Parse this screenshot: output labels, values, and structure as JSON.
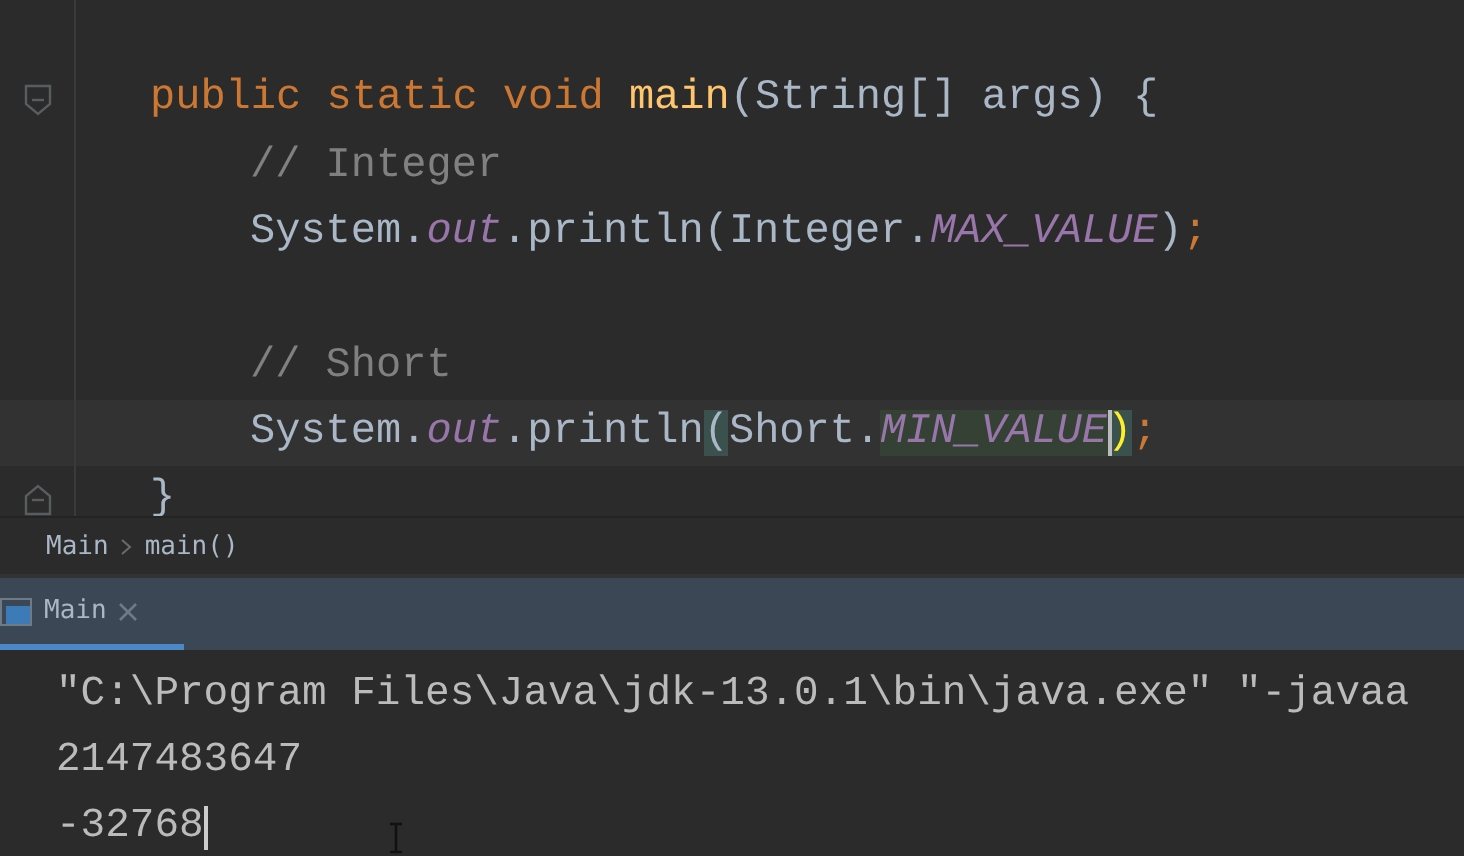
{
  "editor": {
    "lines": [
      {
        "kind": "blank"
      },
      {
        "kind": "fold-start",
        "tokens": [
          {
            "kind": "keyword",
            "text": "public static void "
          },
          {
            "kind": "method",
            "text": "main"
          },
          {
            "kind": "plain",
            "text": "(String[] args) {"
          }
        ]
      },
      {
        "kind": "body",
        "tokens": [
          {
            "kind": "comment",
            "text": "// Integer"
          }
        ]
      },
      {
        "kind": "body",
        "tokens": [
          {
            "kind": "plain",
            "text": "System."
          },
          {
            "kind": "static-field",
            "text": "out"
          },
          {
            "kind": "plain",
            "text": ".println(Integer."
          },
          {
            "kind": "static-field",
            "text": "MAX_VALUE"
          },
          {
            "kind": "plain",
            "text": ")"
          },
          {
            "kind": "punct",
            "text": ";"
          }
        ]
      },
      {
        "kind": "blank"
      },
      {
        "kind": "body",
        "tokens": [
          {
            "kind": "comment",
            "text": "// Short"
          }
        ]
      },
      {
        "kind": "caret-line",
        "tokens": [
          {
            "kind": "plain",
            "text": "System."
          },
          {
            "kind": "static-field",
            "text": "out"
          },
          {
            "kind": "plain",
            "text": ".println"
          },
          {
            "kind": "brace-match",
            "text": "("
          },
          {
            "kind": "plain",
            "text": "Short."
          },
          {
            "kind": "static-field-marked",
            "text": "MIN_VALUE"
          },
          {
            "kind": "brace-match-caret",
            "text": ")"
          },
          {
            "kind": "punct",
            "text": ";"
          }
        ]
      },
      {
        "kind": "fold-end",
        "tokens": [
          {
            "kind": "plain",
            "text": "}"
          }
        ]
      }
    ]
  },
  "breadcrumbs": [
    "Main",
    "main()"
  ],
  "run_panel": {
    "tabs": [
      {
        "label": "Main",
        "selected": true
      }
    ],
    "output": [
      "\"C:\\Program Files\\Java\\jdk-13.0.1\\bin\\java.exe\" \"-javaa",
      "2147483647",
      "-32768"
    ]
  }
}
